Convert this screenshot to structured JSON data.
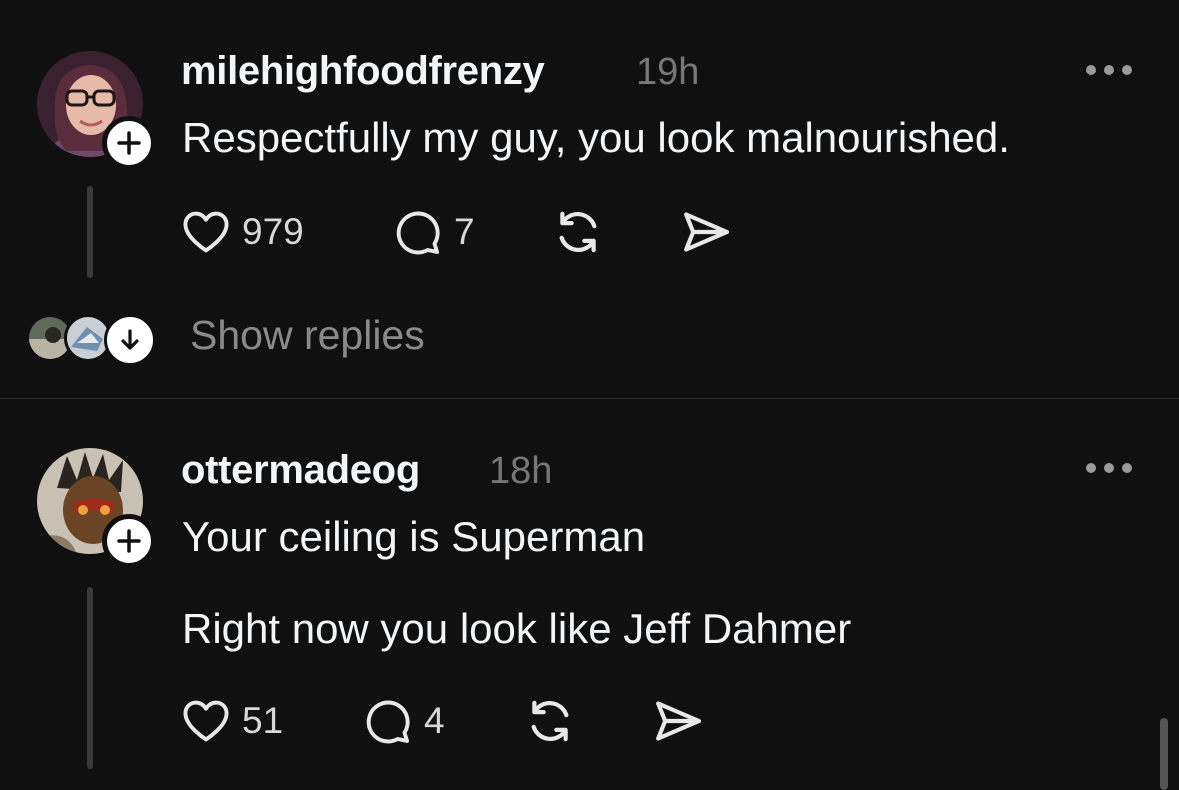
{
  "posts": [
    {
      "username": "milehighfoodfrenzy",
      "time": "19h",
      "lines": [
        "Respectfully my guy, you look malnourished."
      ],
      "likes": "979",
      "replies": "7"
    },
    {
      "username": "ottermadeog",
      "time": "18h",
      "lines": [
        "Your ceiling is Superman",
        "Right now you look like Jeff Dahmer"
      ],
      "likes": "51",
      "replies": "4"
    }
  ],
  "show_replies_label": "Show replies",
  "icons": {
    "more": "more-horizontal-icon",
    "like": "heart-icon",
    "reply": "comment-icon",
    "repost": "repost-icon",
    "share": "send-icon",
    "follow": "plus-icon",
    "expand": "arrow-down-icon"
  },
  "colors": {
    "background": "#101010",
    "text": "#f3f5f7",
    "secondary_text": "#777777"
  }
}
